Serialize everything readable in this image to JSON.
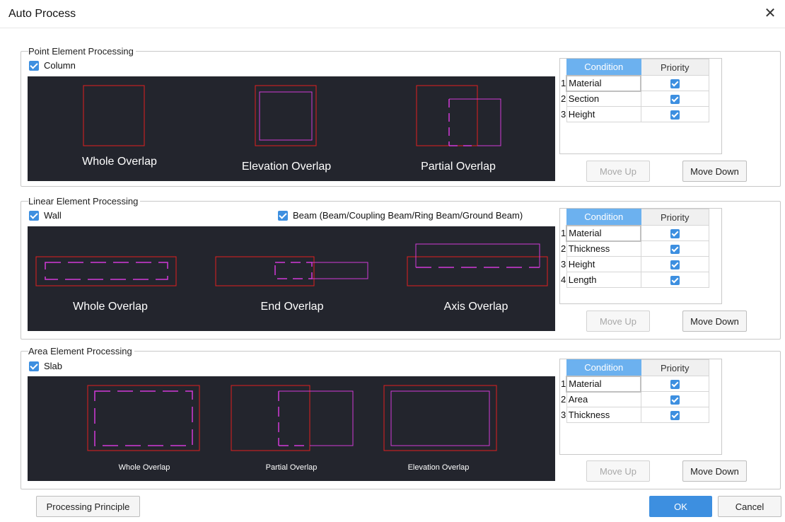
{
  "window": {
    "title": "Auto Process",
    "close_glyph": "✕"
  },
  "point": {
    "legend": "Point Element Processing",
    "checkbox_label": "Column",
    "labels": [
      "Whole Overlap",
      "Elevation Overlap",
      "Partial Overlap"
    ],
    "table": {
      "header_condition": "Condition",
      "header_priority": "Priority",
      "rows": [
        {
          "index": "1",
          "name": "Material",
          "checked": true
        },
        {
          "index": "2",
          "name": "Section",
          "checked": true
        },
        {
          "index": "3",
          "name": "Height",
          "checked": true
        }
      ]
    },
    "move_up": "Move Up",
    "move_down": "Move Down"
  },
  "linear": {
    "legend": "Linear Element Processing",
    "checkbox_wall": "Wall",
    "checkbox_beam": "Beam (Beam/Coupling Beam/Ring Beam/Ground Beam)",
    "labels": [
      "Whole Overlap",
      "End Overlap",
      "Axis Overlap"
    ],
    "table": {
      "header_condition": "Condition",
      "header_priority": "Priority",
      "rows": [
        {
          "index": "1",
          "name": "Material",
          "checked": true
        },
        {
          "index": "2",
          "name": "Thickness",
          "checked": true
        },
        {
          "index": "3",
          "name": "Height",
          "checked": true
        },
        {
          "index": "4",
          "name": "Length",
          "checked": true
        }
      ]
    },
    "move_up": "Move Up",
    "move_down": "Move Down"
  },
  "area": {
    "legend": "Area Element Processing",
    "checkbox_label": "Slab",
    "labels": [
      "Whole Overlap",
      "Partial Overlap",
      "Elevation Overlap"
    ],
    "table": {
      "header_condition": "Condition",
      "header_priority": "Priority",
      "rows": [
        {
          "index": "1",
          "name": "Material",
          "checked": true
        },
        {
          "index": "2",
          "name": "Area",
          "checked": true
        },
        {
          "index": "3",
          "name": "Thickness",
          "checked": true
        }
      ]
    },
    "move_up": "Move Up",
    "move_down": "Move Down"
  },
  "footer": {
    "principle": "Processing Principle",
    "ok": "OK",
    "cancel": "Cancel"
  },
  "colors": {
    "accent": "#3d8fe0",
    "header_blue": "#6cb1ef",
    "canvas_bg": "#23252d",
    "red_outline": "#e02020",
    "magenta_outline": "#d23ad8"
  }
}
